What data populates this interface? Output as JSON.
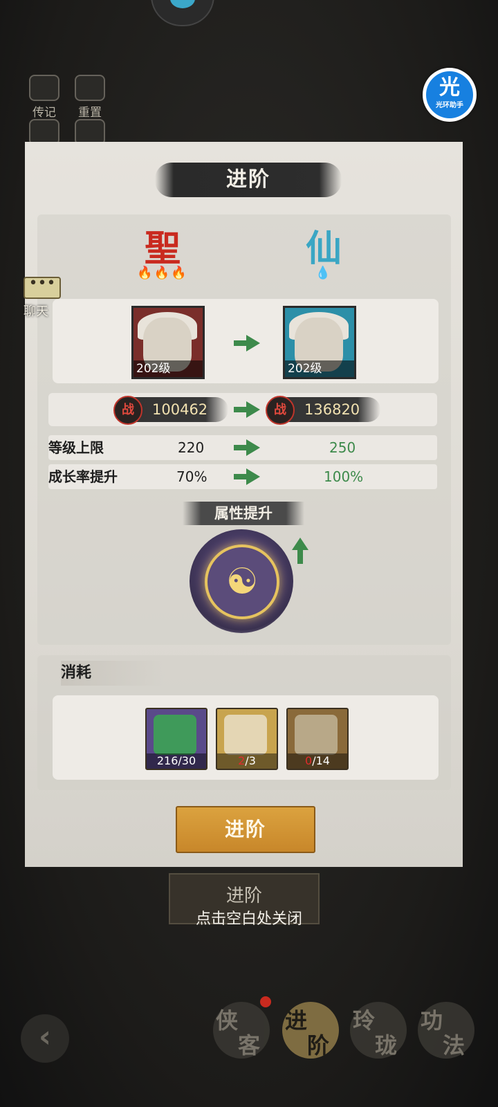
{
  "top_bar": {
    "left_icons": [
      "传记",
      "重置"
    ]
  },
  "assistant": {
    "glyph": "光",
    "label": "光环助手"
  },
  "chat": {
    "dots": "•••",
    "label": "聊天"
  },
  "panel": {
    "title": "进阶",
    "rank_from": {
      "glyph": "聖",
      "color": "#c92a1f"
    },
    "rank_to": {
      "glyph": "仙",
      "color": "#3aa6c4"
    },
    "hero_from_level": "202级",
    "hero_to_level": "202级",
    "power_icon": "战",
    "power_from": "100462",
    "power_to": "136820",
    "level_cap_label": "等级上限",
    "level_cap_from": "220",
    "level_cap_to": "250",
    "growth_label": "成长率提升",
    "growth_from": "70%",
    "growth_to": "100%",
    "attr_label": "属性提升",
    "orb_glyph": "☯",
    "cost_title": "消耗",
    "cost_items": [
      {
        "count": "216/30",
        "color": "#5a4a8a"
      },
      {
        "count_have": "2",
        "count_need": "/3",
        "color": "#c8a44e"
      },
      {
        "count_have": "0",
        "count_need": "/14",
        "color": "#8a6a3a"
      }
    ],
    "advance_button": "进阶"
  },
  "behind_button": "进阶",
  "close_hint": "点击空白处关闭",
  "bottom_tabs": [
    "侠客",
    "进阶",
    "玲珑",
    "功法"
  ],
  "back_glyph": "‹"
}
